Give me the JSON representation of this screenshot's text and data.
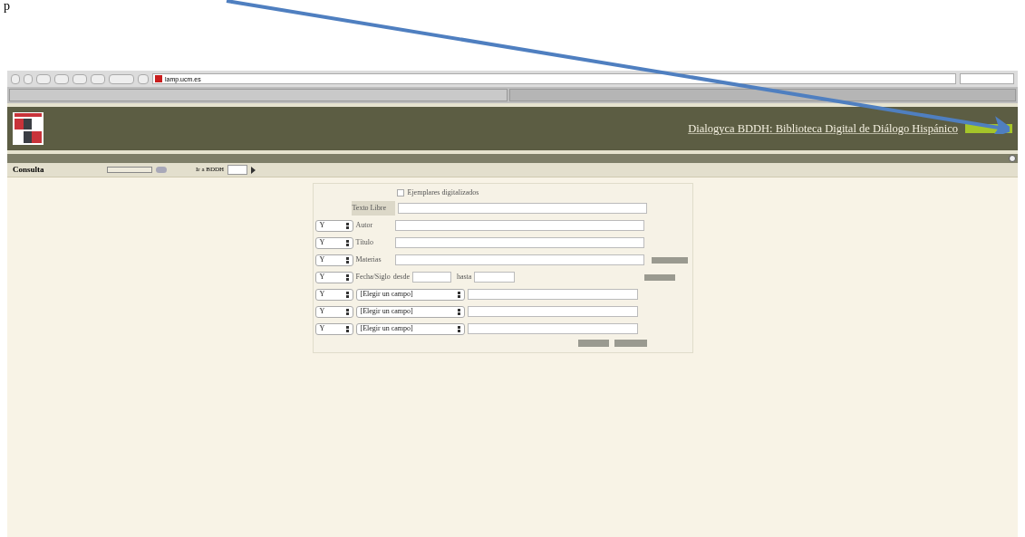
{
  "document_text": "p",
  "browser": {
    "url": "lamp.ucm.es"
  },
  "header": {
    "title": "Dialogyca BDDH: Biblioteca Digital de Diálogo Hispánico"
  },
  "nav": {
    "section": "Consulta",
    "goto_label": "Ir a BDDH"
  },
  "form": {
    "digitized": {
      "label": "Ejemplares digitalizados",
      "checked": false
    },
    "rows": [
      {
        "kind": "text",
        "label": "Texto Libre"
      },
      {
        "kind": "op",
        "op": "Y",
        "label": "Autor"
      },
      {
        "kind": "op",
        "op": "Y",
        "label": "Título"
      },
      {
        "kind": "op_side",
        "op": "Y",
        "label": "Materias"
      },
      {
        "kind": "range",
        "op": "Y",
        "label": "Fecha/Siglo",
        "from": "desde",
        "to": "hasta"
      },
      {
        "kind": "field",
        "op": "Y",
        "field": "[Elegir un campo]"
      },
      {
        "kind": "field",
        "op": "Y",
        "field": "[Elegir un campo]"
      },
      {
        "kind": "field",
        "op": "Y",
        "field": "[Elegir un campo]"
      }
    ]
  }
}
